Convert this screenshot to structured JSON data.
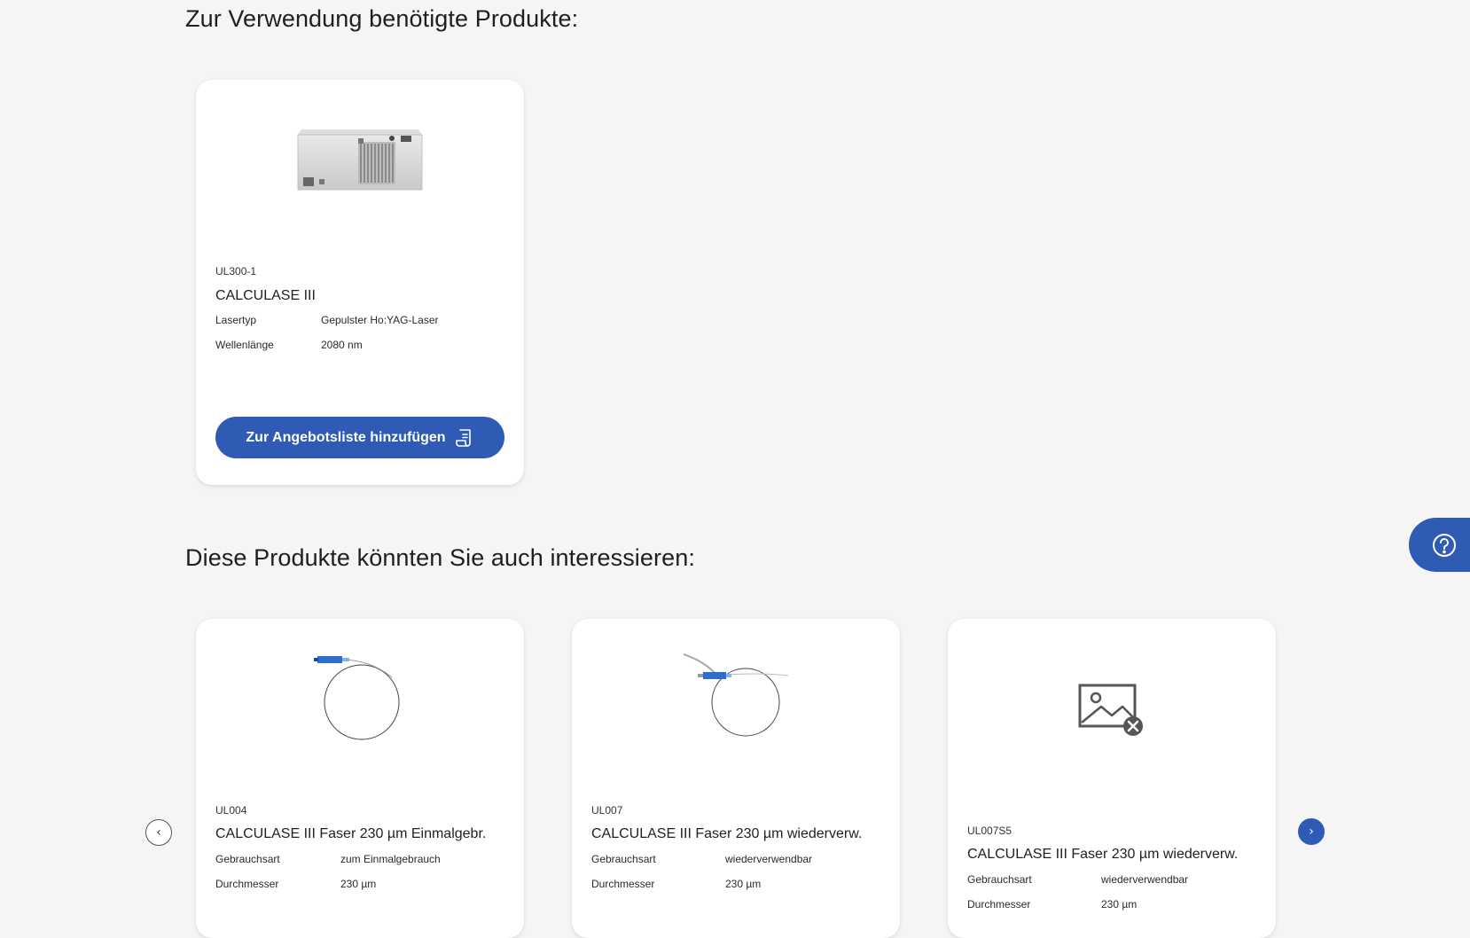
{
  "sections": {
    "required_title": "Zur Verwendung benötigte Produkte:",
    "related_title": "Diese Produkte könnten Sie auch interessieren:"
  },
  "required_products": [
    {
      "sku": "UL300-1",
      "name": "CALCULASE III",
      "attributes": [
        {
          "label": "Lasertyp",
          "value": "Gepulster Ho:YAG-Laser"
        },
        {
          "label": "Wellenlänge",
          "value": "2080 nm"
        }
      ],
      "cta_label": "Zur Angebotsliste hinzufügen",
      "image_icon": "laser-device-image"
    }
  ],
  "related_products": [
    {
      "sku": "UL004",
      "name": "CALCULASE III Faser 230 µm Einmalgebr.",
      "attributes": [
        {
          "label": "Gebrauchsart",
          "value": "zum Einmalgebrauch"
        },
        {
          "label": "Durchmesser",
          "value": "230 µm"
        }
      ],
      "image_icon": "fiber-coil-image"
    },
    {
      "sku": "UL007",
      "name": "CALCULASE III Faser 230 µm wiederverw.",
      "attributes": [
        {
          "label": "Gebrauchsart",
          "value": "wiederverwendbar"
        },
        {
          "label": "Durchmesser",
          "value": "230 µm"
        }
      ],
      "image_icon": "fiber-coil-image"
    },
    {
      "sku": "UL007S5",
      "name": "CALCULASE III Faser 230 µm wiederverw.",
      "attributes": [
        {
          "label": "Gebrauchsart",
          "value": "wiederverwendbar"
        },
        {
          "label": "Durchmesser",
          "value": "230 µm"
        }
      ],
      "image_icon": "image-missing-icon"
    }
  ],
  "carousel": {
    "prev_glyph": "‹",
    "next_glyph": "›"
  },
  "icons": {
    "cta": "quote-list-icon",
    "help": "help-question-icon"
  },
  "colors": {
    "accent": "#2f5bb5",
    "background": "#f5f5f5",
    "card": "#ffffff"
  }
}
